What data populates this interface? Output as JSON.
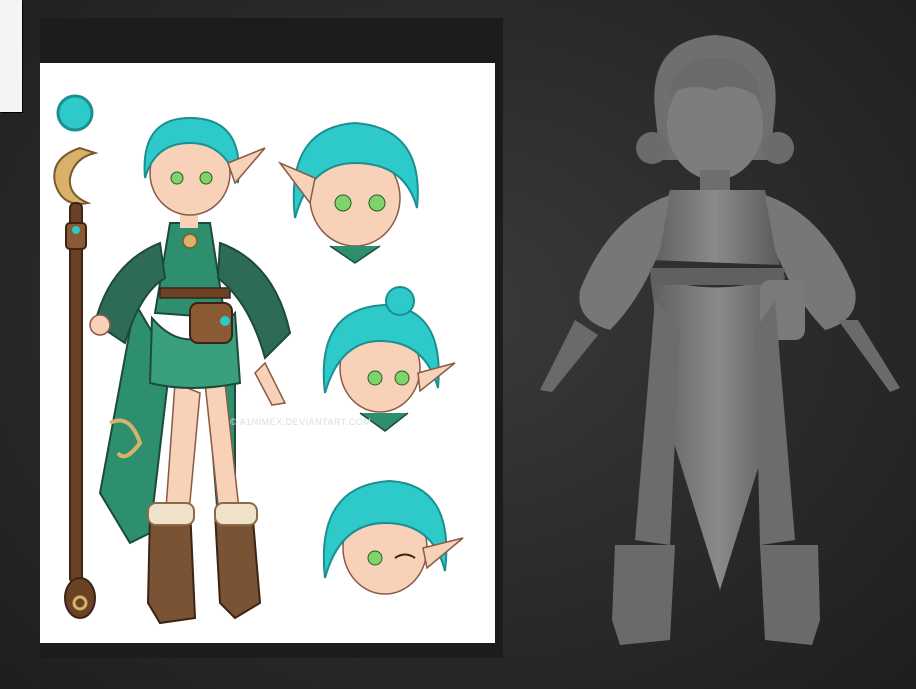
{
  "reference": {
    "watermark": "© A1NIMEX.DEVIANTART.COM"
  },
  "colors": {
    "background": "#2a2a2a",
    "hair": "#2ec9c9",
    "dress": "#2e8f6e",
    "sleeve": "#2d6b55",
    "staff": "#6b4226",
    "boots": "#7a5234",
    "skin": "#f7d2b8",
    "eyes": "#7fd36b",
    "sculpt_clay": "#7d7d7d"
  },
  "icons": [
    "elf-character-full-body",
    "elf-head-view",
    "elf-head-view",
    "elf-head-view-winking",
    "sculpt-model-3d"
  ]
}
